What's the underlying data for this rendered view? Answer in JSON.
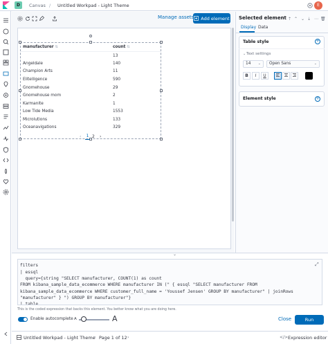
{
  "header": {
    "space_initial": "D",
    "breadcrumb_app": "Canvas",
    "breadcrumb_sep": "/",
    "breadcrumb_page": "Untitled Workpad - Light Theme",
    "avatar_initial": "E"
  },
  "toolbar": {
    "manage_assets": "Manage assets",
    "add_element": "Add element"
  },
  "table": {
    "headers": [
      "manufacturer",
      "count"
    ],
    "rows": [
      [
        "",
        "13"
      ],
      [
        "Angeldale",
        "140"
      ],
      [
        "Champion Arts",
        "11"
      ],
      [
        "Elitelligence",
        "590"
      ],
      [
        "Gnomehouse",
        "29"
      ],
      [
        "Gnomehouse mom",
        "2"
      ],
      [
        "Karmanite",
        "1"
      ],
      [
        "Low Tide Media",
        "1553"
      ],
      [
        "Microlutions",
        "133"
      ],
      [
        "Oceanavigations",
        "329"
      ]
    ],
    "pager": {
      "prev": "‹",
      "page1": "1",
      "page2": "2",
      "next": "›"
    }
  },
  "sidebar": {
    "title": "Selected element",
    "tabs": [
      "Display",
      "Data"
    ],
    "table_style_title": "Table style",
    "text_settings_label": "Text settings",
    "font_size": "14",
    "font_family": "Open Sans",
    "format_buttons": [
      "B",
      "I",
      "U"
    ],
    "text_color": "#000000",
    "element_style_title": "Element style"
  },
  "editor": {
    "code_lines": [
      "filters",
      "| essql",
      "  query={string \"SELECT manufacturer, COUNT(1) as count",
      "FROM kibana_sample_data_ecommerce WHERE manufacturer IN (\" { essql \"SELECT manufacturer FROM",
      "kibana_sample_data_ecommerce WHERE customer_full_name = 'Youssef Jensen' GROUP BY manufacturer\" | joinRows",
      "\"manufacturer\" } \") GROUP BY manufacturer\"}",
      "| table"
    ],
    "help_text": "This is the coded expression that backs this element. You better know what you are doing here.",
    "autocomplete_label": "Enable autocomplete",
    "font_small": "A",
    "font_large": "A",
    "close_label": "Close",
    "run_label": "Run"
  },
  "footer": {
    "workpad_name": "Untitled Workpad - Light Theme",
    "page_indicator": "Page 1 of 12",
    "expression_editor": "Expression editor"
  },
  "colors": {
    "accent": "#006bb8",
    "space_badge": "#6dccb1",
    "avatar": "#e7664c"
  }
}
